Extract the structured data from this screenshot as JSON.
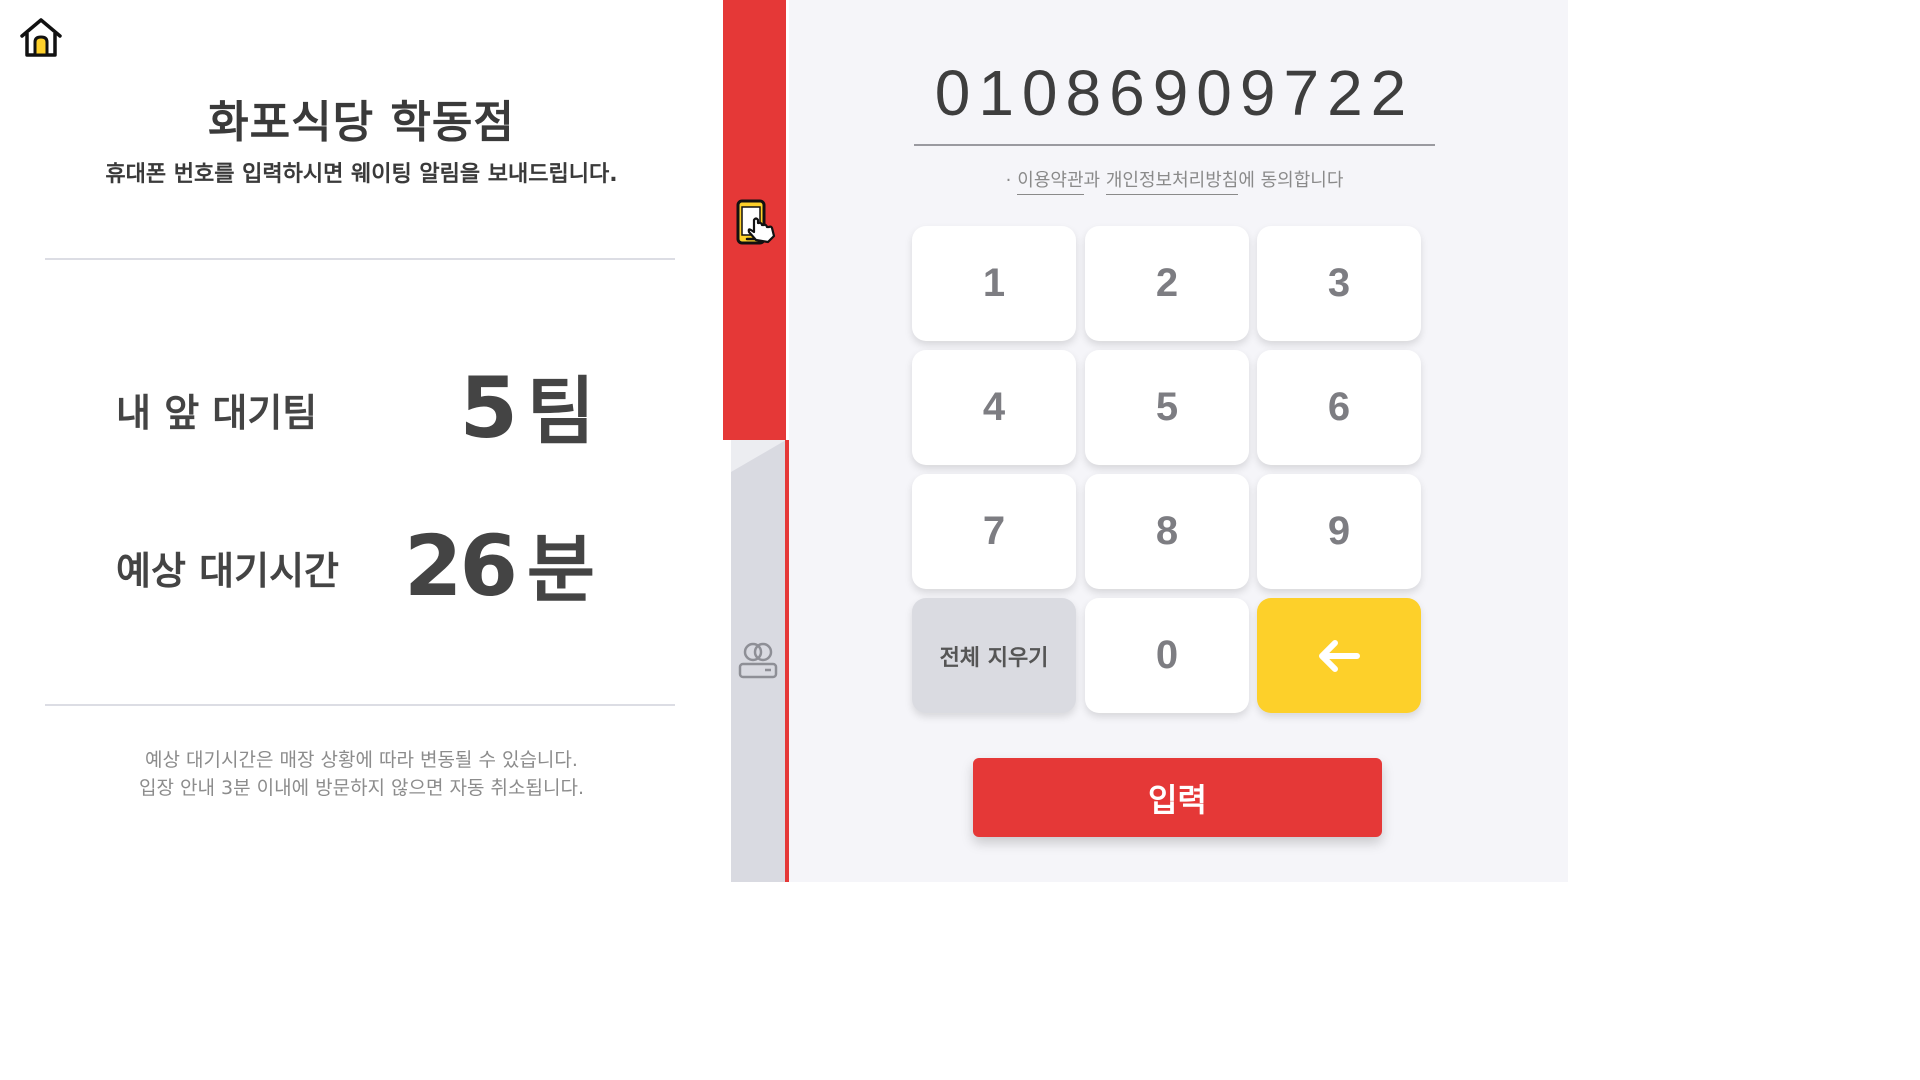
{
  "store": {
    "name": "화포식당 학동점",
    "subtitle": "휴대폰 번호를 입력하시면 웨이팅 알림을 보내드립니다."
  },
  "stats": {
    "teams_ahead": {
      "label": "내 앞 대기팀",
      "value": "5",
      "unit": "팀"
    },
    "wait_time": {
      "label": "예상 대기시간",
      "value": "26",
      "unit": "분"
    }
  },
  "notes": {
    "line1": "예상 대기시간은 매장 상황에 따라 변동될 수 있습니다.",
    "line2": "입장 안내 3분 이내에 방문하지 않으면 자동 취소됩니다."
  },
  "phone_input": {
    "value": "01086909722"
  },
  "terms": {
    "dot": "·",
    "link1": "이용약관",
    "mid": "과 ",
    "link2": "개인정보처리방침",
    "end": "에 동의합니다"
  },
  "keypad": {
    "k1": "1",
    "k2": "2",
    "k3": "3",
    "k4": "4",
    "k5": "5",
    "k6": "6",
    "k7": "7",
    "k8": "8",
    "k9": "9",
    "clear": "전체 지우기",
    "k0": "0"
  },
  "submit_label": "입력",
  "icons": {
    "home": "home-icon",
    "phone_touch": "phone-touch-icon",
    "waiting": "waiting-people-icon",
    "backspace": "arrow-left-icon"
  },
  "colors": {
    "accent_red": "#e53837",
    "accent_yellow": "#fdd02a",
    "text_dark": "#3a3a3a"
  }
}
